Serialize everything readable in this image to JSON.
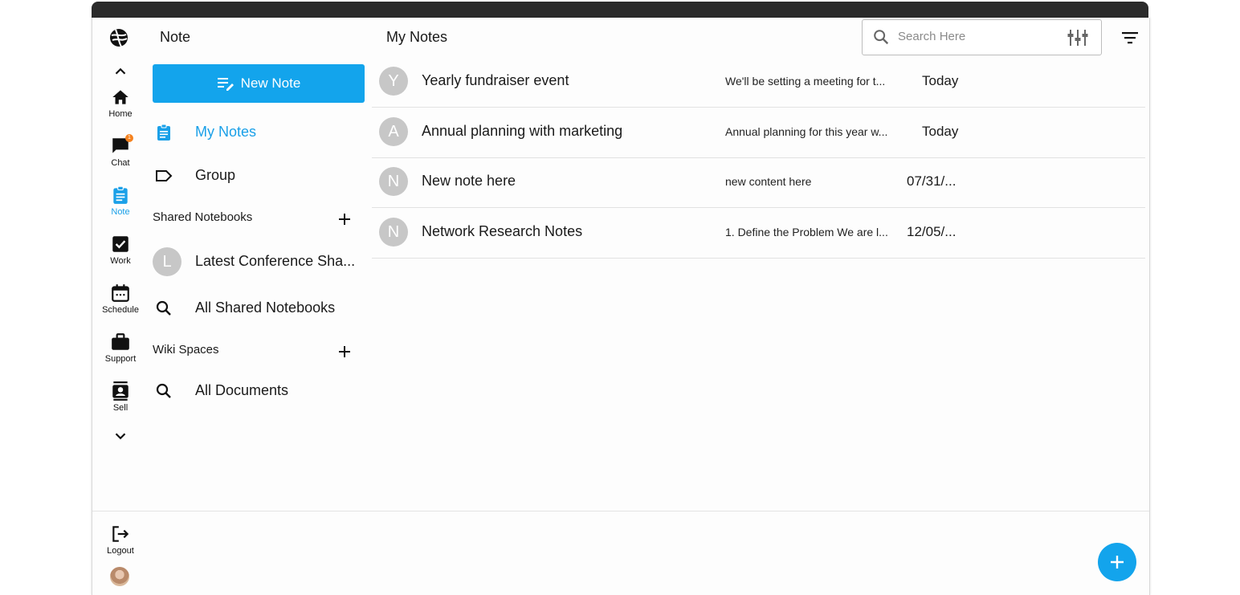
{
  "rail": {
    "items": [
      {
        "label": "Home"
      },
      {
        "label": "Chat",
        "badge": "1"
      },
      {
        "label": "Note"
      },
      {
        "label": "Work"
      },
      {
        "label": "Schedule"
      },
      {
        "label": "Support"
      },
      {
        "label": "Sell"
      }
    ],
    "logout_label": "Logout",
    "active_item": "Note"
  },
  "sidebar": {
    "title": "Note",
    "new_note_label": "New Note",
    "items": [
      {
        "label": "My Notes"
      },
      {
        "label": "Group"
      }
    ],
    "shared_notebooks": {
      "heading": "Shared Notebooks",
      "notebooks": [
        {
          "initial": "L",
          "label": "Latest Conference Sha..."
        }
      ],
      "all_label": "All Shared Notebooks"
    },
    "wiki_spaces": {
      "heading": "Wiki Spaces",
      "all_label": "All Documents"
    }
  },
  "main": {
    "title": "My Notes",
    "search": {
      "placeholder": "Search Here"
    },
    "notes": [
      {
        "initial": "Y",
        "title": "Yearly fundraiser event",
        "snippet": "We'll be setting a meeting for t...",
        "date": "Today"
      },
      {
        "initial": "A",
        "title": "Annual planning with marketing",
        "snippet": "Annual planning for this year w...",
        "date": "Today"
      },
      {
        "initial": "N",
        "title": "New note here",
        "snippet": "new content here",
        "date": "07/31/..."
      },
      {
        "initial": "N",
        "title": "Network Research Notes",
        "snippet": "1. Define the Problem We are l...",
        "date": "12/05/..."
      }
    ]
  },
  "colors": {
    "accent": "#13a4ec",
    "badge": "#f5821f",
    "avatar_gray": "#c7c7c7"
  }
}
